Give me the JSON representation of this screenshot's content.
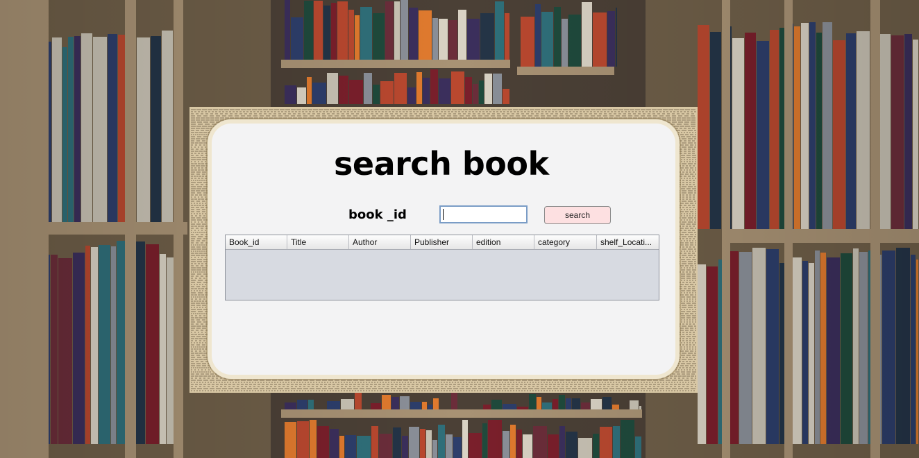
{
  "window": {
    "title": "search book"
  },
  "form": {
    "id_label": "book _id",
    "id_value": "",
    "search_label": "search"
  },
  "table": {
    "columns": [
      "Book_id",
      "Title",
      "Author",
      "Publisher",
      "edition",
      "category",
      "shelf_Locati..."
    ],
    "rows": []
  },
  "colors": {
    "panel": "#f3f3f4",
    "button": "#fde0e1",
    "table_body": "#d7dae1",
    "input_border": "#7a9cc6"
  }
}
